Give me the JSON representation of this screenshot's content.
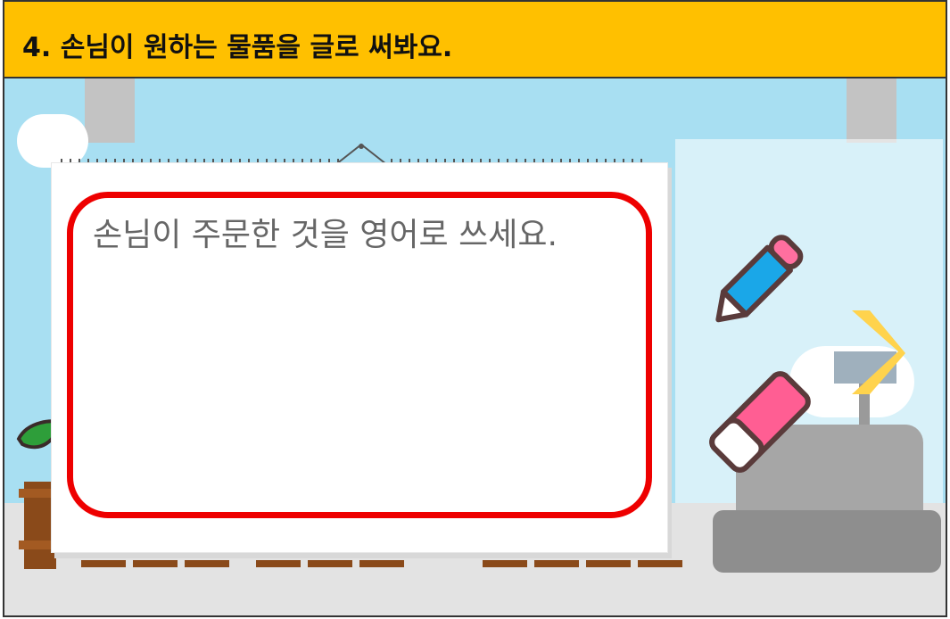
{
  "header": {
    "title": "4. 손님이 원하는 물품을 글로 써봐요."
  },
  "notebook": {
    "prompt": "손님이 주문한 것을 영어로 쓰세요.",
    "answer_value": ""
  },
  "tools": {
    "pencil_icon": "pencil-icon",
    "eraser_icon": "eraser-icon",
    "next_icon": "chevron-right-icon"
  },
  "colors": {
    "header_bg": "#ffc000",
    "answer_border": "#ee0000",
    "pencil_body": "#1aa7e8",
    "eraser_body": "#ff5e93",
    "arrow": "#ffd34d"
  }
}
